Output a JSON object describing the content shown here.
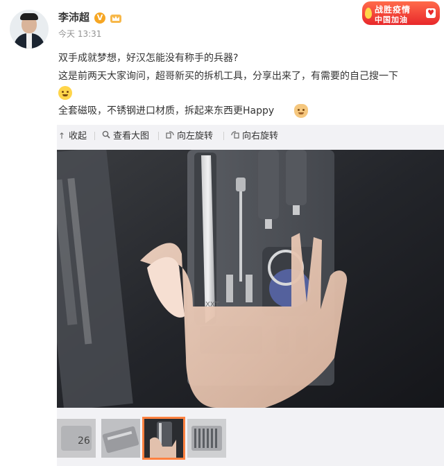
{
  "user": {
    "name": "李沛超",
    "verified_badge": "V",
    "post_time": "今天 13:31"
  },
  "campaign_badge": {
    "line1": "战胜疫情",
    "line2": "中国加油"
  },
  "post": {
    "line1": "双手成就梦想，好汉怎能没有称手的兵器?",
    "line2": "这是前两天大家询问，超哥新买的拆机工具，分享出来了，有需要的自己搜一下",
    "line3": "全套磁吸，不锈钢进口材质，拆起来东西更Happy"
  },
  "toolbar": {
    "collapse": "收起",
    "view_large": "查看大图",
    "rotate_left": "向左旋转",
    "rotate_right": "向右旋转"
  },
  "photo": {
    "tool_brand_mark": "XXT"
  },
  "thumbnails": {
    "count": 4,
    "selected_index": 2,
    "thumb1_label": "26"
  },
  "colors": {
    "accent_selected": "#ff8140",
    "verified": "#f6a623",
    "panel_bg": "#f2f2f5"
  }
}
